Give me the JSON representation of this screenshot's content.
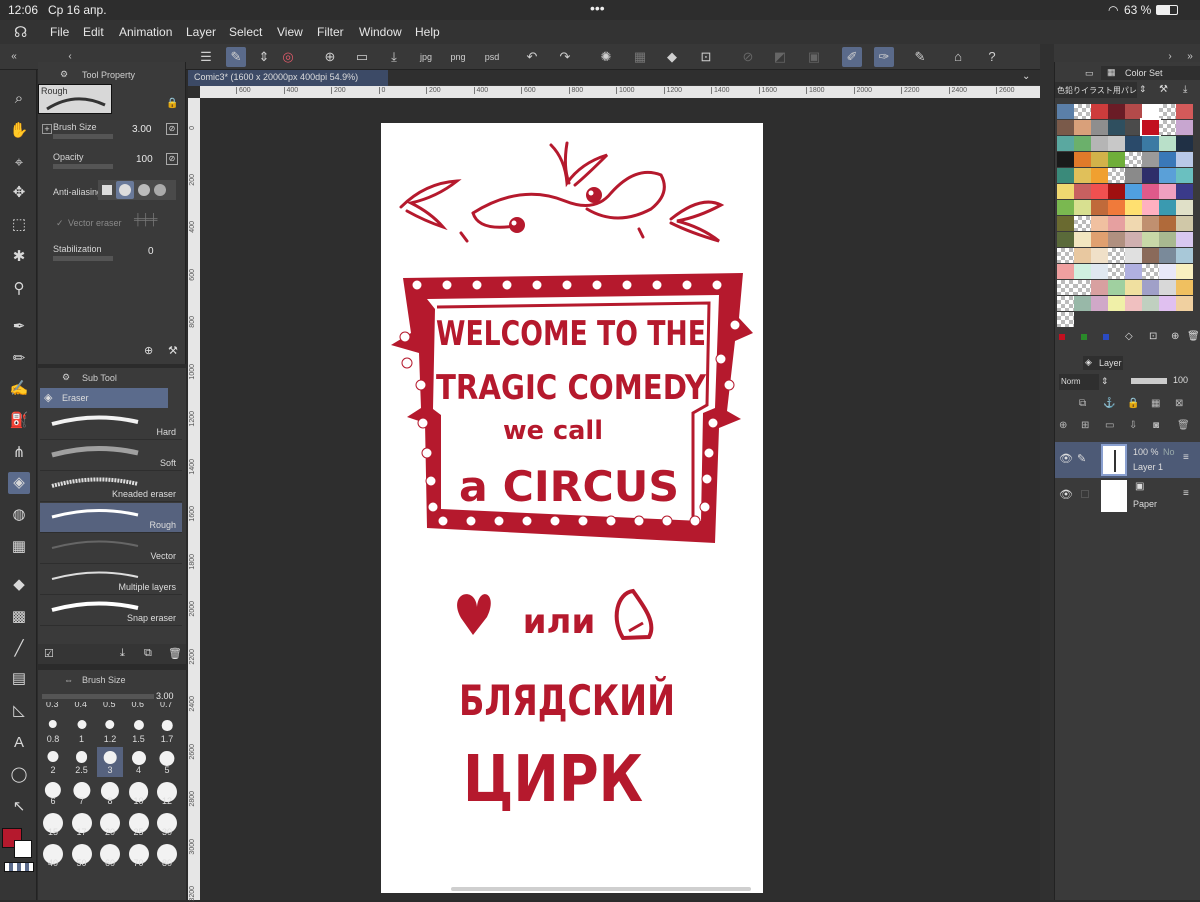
{
  "status": {
    "time": "12:06",
    "date": "Ср 16 апр.",
    "battery": "63 %"
  },
  "menu": [
    "File",
    "Edit",
    "Animation",
    "Layer",
    "Select",
    "View",
    "Filter",
    "Window",
    "Help"
  ],
  "tool_property": {
    "title": "Tool Property",
    "preset": "Rough",
    "brush_size_label": "Brush Size",
    "brush_size_value": "3.00",
    "opacity_label": "Opacity",
    "opacity_value": "100",
    "antialias_label": "Anti-aliasing",
    "vector_eraser_label": "Vector eraser",
    "stabilization_label": "Stabilization",
    "stabilization_value": "0"
  },
  "sub_tool": {
    "title": "Sub Tool",
    "group": "Eraser",
    "items": [
      "Hard",
      "Soft",
      "Kneaded eraser",
      "Rough",
      "Vector",
      "Multiple layers",
      "Snap eraser"
    ]
  },
  "brush_size_panel": {
    "title": "Brush Size",
    "value": "3.00",
    "partial_top": [
      "0.3",
      "0.4",
      "0.5",
      "0.6",
      "0.7"
    ],
    "sizes": [
      "0.8",
      "1",
      "1.2",
      "1.5",
      "1.7",
      "2",
      "2.5",
      "3",
      "4",
      "5",
      "6",
      "7",
      "8",
      "10",
      "12",
      "15",
      "17",
      "20",
      "25",
      "30",
      "40",
      "50",
      "60",
      "70",
      "80"
    ]
  },
  "document_tab": "Comic3* (1600 x 20000px 400dpi 54.9%)",
  "ruler_top": [
    "600",
    "400",
    "200",
    "0",
    "200",
    "400",
    "600",
    "800",
    "1000",
    "1200",
    "1400",
    "1600",
    "1800",
    "2000",
    "2200",
    "2400",
    "2600"
  ],
  "ruler_left": [
    "0",
    "200",
    "400",
    "600",
    "800",
    "1000",
    "1200",
    "1400",
    "1600",
    "1800",
    "2000",
    "2200",
    "2400",
    "2600",
    "2800",
    "3000",
    "3200"
  ],
  "artwork": {
    "line1": "WELCOME TO THE",
    "line2": "TRAGIC COMEDY",
    "line3": "we call",
    "line4": "a CIRCUS",
    "line5": "или",
    "line6": "БЛЯДСКИЙ",
    "line7": "ЦИРК",
    "ink_color": "#b5192d"
  },
  "color_set": {
    "title": "Color Set",
    "set_name": "色鉛りイラスト用パレット",
    "swatches": [
      "#5b7fa8",
      "#c9c9c9",
      "#cd3c3c",
      "#6a1c26",
      "#b34a4a",
      "#fff",
      "#c9c9c9",
      "#d35a5a",
      "#7a5a4a",
      "#d9a07a",
      "#8e8e8e",
      "#2f4f5f",
      "#4b4b4b",
      "#c21020",
      "#c9c9c9",
      "#c8a6d0",
      "#5aa8a0",
      "#6bb06b",
      "#b5b5b5",
      "#c8c8c8",
      "#2a4a6a",
      "#3b7aa3",
      "#b9e0c9",
      "#203045",
      "#1a1a1a",
      "#e07a2a",
      "#d2b24a",
      "#6fae3a",
      "#c9c9c9",
      "#9a9a9a",
      "#3a78b8",
      "#b9c9e8",
      "#3a8a7a",
      "#e0c05a",
      "#f0a030",
      "#c9c9c9",
      "#8a8a8a",
      "#2e2e6a",
      "#5aa0d8",
      "#6ac0c0",
      "#f0d870",
      "#c86060",
      "#f05050",
      "#a01010",
      "#50a0e0",
      "#e05a8a",
      "#f0a0c0",
      "#3a3a8a",
      "#7ab850",
      "#d8e090",
      "#c06a3a",
      "#f07a3a",
      "#ffe070",
      "#ffb0c0",
      "#3a9ab0",
      "#e0e0c8",
      "#6a6a30",
      "#c9c9c9",
      "#f0c0a0",
      "#e6a0a0",
      "#f0d8b0",
      "#c09070",
      "#b06a3a",
      "#d0c8a8",
      "#5a6a3a",
      "#f2e6c0",
      "#e0a070",
      "#b09080",
      "#d0b0b0",
      "#c8d8a8",
      "#a8b890",
      "#d8c8f0",
      "#c9c9c9",
      "#e8c8a0",
      "#f0e0c8",
      "#c9c9c9",
      "#e0e0e0",
      "#8a6a5a",
      "#7a8a9a",
      "#a8c8d8",
      "#f0a0a0",
      "#d0f0e0",
      "#e0e8f0",
      "#c9c9c9",
      "#b0b0e0",
      "#c9c9c9",
      "#e8e8f8",
      "#f8f0c0",
      "#c9c9c9",
      "#c9c9c9",
      "#d8a0a0",
      "#a0d0a0",
      "#f0e0a0",
      "#a0a0c8",
      "#d8d8d8",
      "#f0c060",
      "#c9c9c9",
      "#98b8a8",
      "#d0a8c8",
      "#f0f0a8",
      "#f0c0c0",
      "#c0d0c0",
      "#e0c0f0",
      "#f0d0a0",
      "#c9c9c9"
    ]
  },
  "layers": {
    "title": "Layer",
    "blend": "Norm",
    "opacity": "100",
    "items": [
      {
        "name": "Layer 1",
        "opacity": "100 %",
        "mode": "No"
      },
      {
        "name": "Paper"
      }
    ]
  },
  "colors": {
    "accent": "#5b6b8c",
    "main_color": "#b5192d",
    "sub_color": "#ffffff"
  }
}
